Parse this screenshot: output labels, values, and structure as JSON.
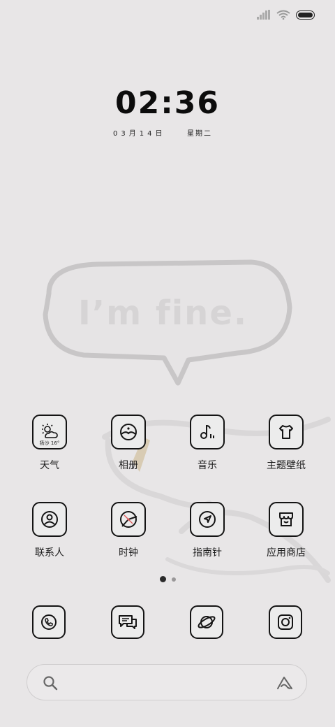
{
  "status_bar": {
    "signal_icon": "signal-icon",
    "wifi_icon": "wifi-icon",
    "battery_icon": "battery-icon"
  },
  "lockscreen_widget": {
    "time": "02:36",
    "date": "03月14日",
    "weekday": "星期二"
  },
  "wallpaper": {
    "text": "I’m fine."
  },
  "apps": [
    {
      "label": "天气",
      "icon": "weather-icon",
      "weather_location": "扬沙",
      "weather_temp": "16°"
    },
    {
      "label": "相册",
      "icon": "gallery-icon"
    },
    {
      "label": "音乐",
      "icon": "music-icon"
    },
    {
      "label": "主题壁纸",
      "icon": "theme-icon"
    },
    {
      "label": "联系人",
      "icon": "contacts-icon"
    },
    {
      "label": "时钟",
      "icon": "clock-icon"
    },
    {
      "label": "指南针",
      "icon": "compass-icon"
    },
    {
      "label": "应用商店",
      "icon": "app-store-icon"
    }
  ],
  "page_indicator": {
    "pages": 2,
    "current": 1
  },
  "dock": [
    {
      "icon": "phone-icon"
    },
    {
      "icon": "messages-icon"
    },
    {
      "icon": "browser-icon"
    },
    {
      "icon": "camera-icon"
    }
  ],
  "search_bar": {
    "search_icon": "search-icon",
    "assistant_icon": "assistant-icon"
  },
  "colors": {
    "background": "#e8e6e7",
    "icon_stroke": "#141414",
    "clock_hand_red": "#e05a5a"
  }
}
